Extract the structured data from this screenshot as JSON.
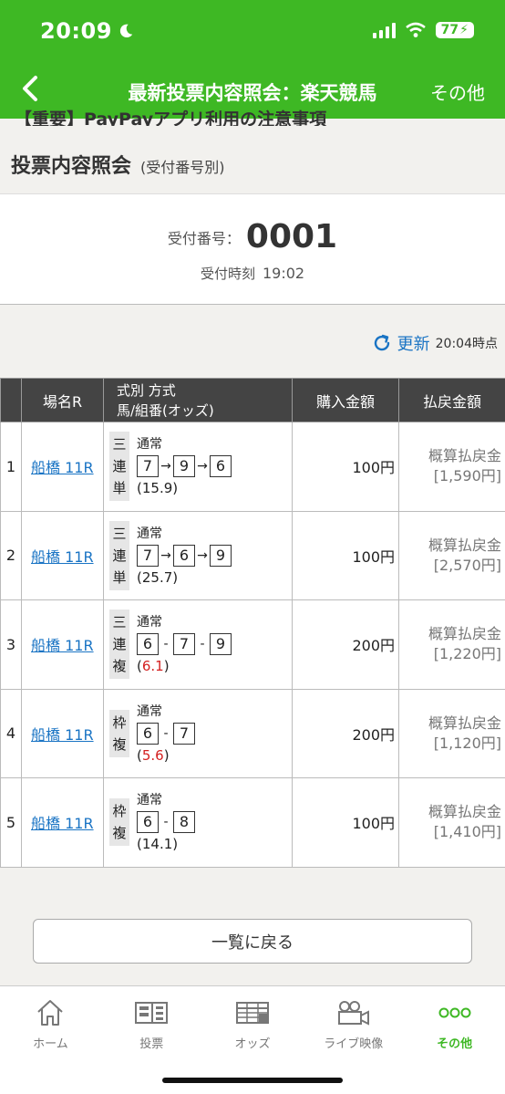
{
  "status": {
    "time": "20:09",
    "battery": "77"
  },
  "nav": {
    "title": "最新投票内容照会：楽天競馬",
    "other": "その他"
  },
  "banner": {
    "text": "【重要】PayPayアプリ利用の注意事項"
  },
  "heading": {
    "title": "投票内容照会",
    "sub": "(受付番号別)"
  },
  "receipt": {
    "label": "受付番号：",
    "number": "0001",
    "time_label": "受付時刻",
    "time": "19:02"
  },
  "refresh": {
    "label": "更新",
    "time": "20:04時点"
  },
  "table": {
    "headers": {
      "venue": "場名R",
      "type1": "式別 方式",
      "type2": "馬/組番(オッズ)",
      "amount": "購入金額",
      "payout": "払戻金額"
    },
    "rows": [
      {
        "no": "1",
        "venue": "船橋 11R",
        "kind": [
          "三",
          "連",
          "単"
        ],
        "mode": "通常",
        "nums": [
          "7",
          "9",
          "6"
        ],
        "sep": "→",
        "odds_open": "(",
        "odds": "15.9",
        "odds_close": ")",
        "odds_red": false,
        "amount": "100円",
        "pay_label": "概算払戻金",
        "pay": "[1,590円]"
      },
      {
        "no": "2",
        "venue": "船橋 11R",
        "kind": [
          "三",
          "連",
          "単"
        ],
        "mode": "通常",
        "nums": [
          "7",
          "6",
          "9"
        ],
        "sep": "→",
        "odds_open": "(",
        "odds": "25.7",
        "odds_close": ")",
        "odds_red": false,
        "amount": "100円",
        "pay_label": "概算払戻金",
        "pay": "[2,570円]"
      },
      {
        "no": "3",
        "venue": "船橋 11R",
        "kind": [
          "三",
          "連",
          "複"
        ],
        "mode": "通常",
        "nums": [
          "6",
          "7",
          "9"
        ],
        "sep": "-",
        "odds_open": "(",
        "odds": "6.1",
        "odds_close": ")",
        "odds_red": true,
        "amount": "200円",
        "pay_label": "概算払戻金",
        "pay": "[1,220円]"
      },
      {
        "no": "4",
        "venue": "船橋 11R",
        "kind": [
          "枠",
          "複"
        ],
        "mode": "通常",
        "nums": [
          "6",
          "7"
        ],
        "sep": "-",
        "odds_open": "(",
        "odds": "5.6",
        "odds_close": ")",
        "odds_red": true,
        "amount": "200円",
        "pay_label": "概算払戻金",
        "pay": "[1,120円]"
      },
      {
        "no": "5",
        "venue": "船橋 11R",
        "kind": [
          "枠",
          "複"
        ],
        "mode": "通常",
        "nums": [
          "6",
          "8"
        ],
        "sep": "-",
        "odds_open": "(",
        "odds": "14.1",
        "odds_close": ")",
        "odds_red": false,
        "amount": "100円",
        "pay_label": "概算払戻金",
        "pay": "[1,410円]"
      }
    ]
  },
  "back_button": "一覧に戻る",
  "tabs": [
    {
      "label": "ホーム",
      "icon": "home-icon"
    },
    {
      "label": "投票",
      "icon": "ticket-icon"
    },
    {
      "label": "オッズ",
      "icon": "odds-table-icon"
    },
    {
      "label": "ライブ映像",
      "icon": "video-camera-icon"
    },
    {
      "label": "その他",
      "icon": "more-dots-icon"
    }
  ],
  "colors": {
    "brand": "#3eb824",
    "link": "#1a74c4",
    "odds_red": "#d42020"
  }
}
